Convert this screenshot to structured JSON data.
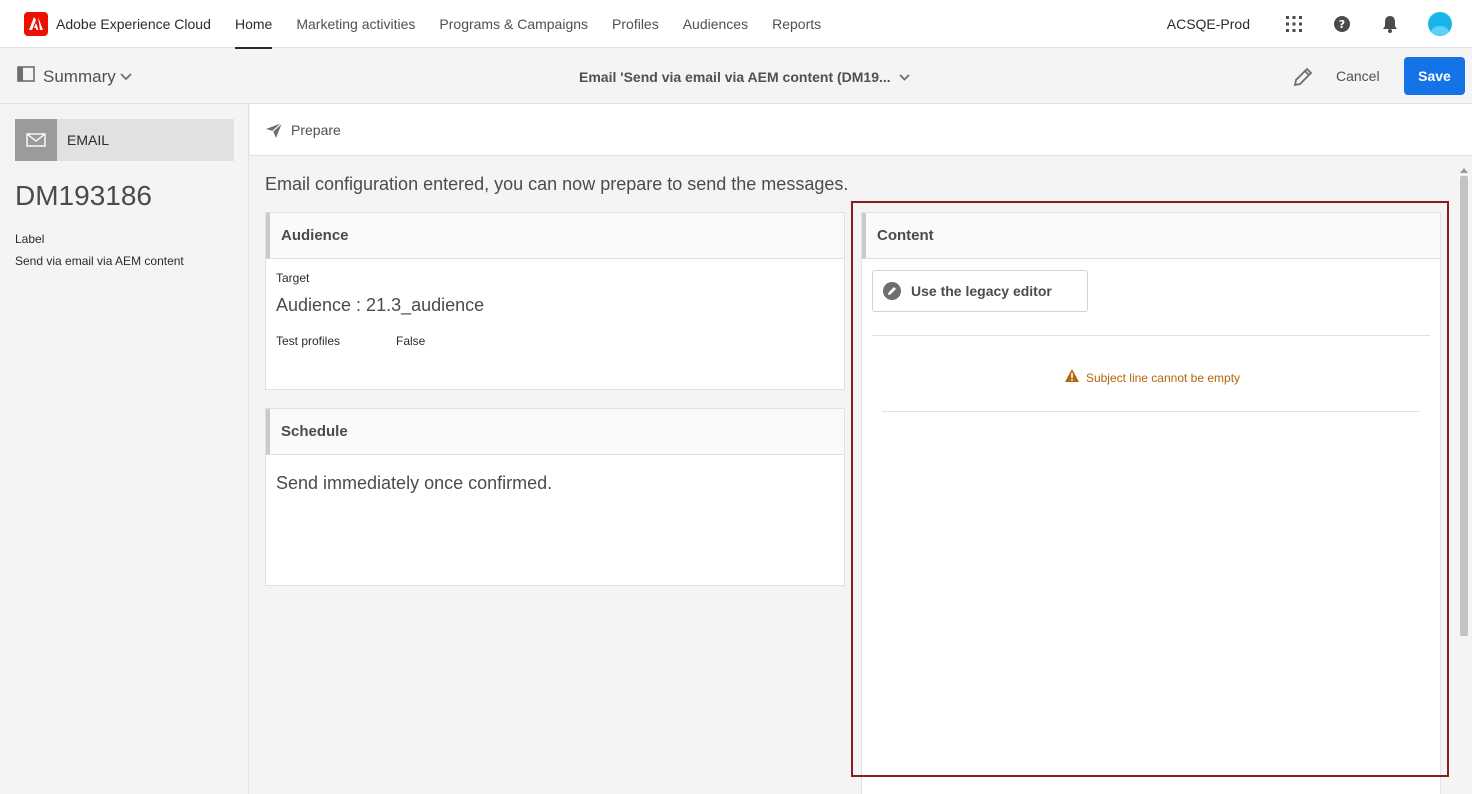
{
  "topnav": {
    "brand": "Adobe Experience Cloud",
    "tabs": [
      "Home",
      "Marketing activities",
      "Programs & Campaigns",
      "Profiles",
      "Audiences",
      "Reports"
    ],
    "active_tab": "Home",
    "org": "ACSQE-Prod",
    "icons": [
      "apps-grid-icon",
      "help-icon",
      "bell-icon",
      "user-avatar"
    ]
  },
  "actionbar": {
    "summary_label": "Summary",
    "title": "Email 'Send via email via AEM content (DM19...",
    "cancel_label": "Cancel",
    "save_label": "Save",
    "accent": "#1473e6"
  },
  "left": {
    "channel": "EMAIL",
    "delivery_id": "DM193186",
    "label_key": "Label",
    "label_value": "Send via email via AEM content"
  },
  "main": {
    "prepare_label": "Prepare",
    "info_message": "Email configuration entered, you can now prepare to send the messages.",
    "audience": {
      "title": "Audience",
      "target_label": "Target",
      "target_value": "Audience : 21.3_audience",
      "test_profiles_label": "Test profiles",
      "test_profiles_value": "False"
    },
    "schedule": {
      "title": "Schedule",
      "value": "Send immediately once confirmed."
    },
    "content": {
      "title": "Content",
      "legacy_editor_label": "Use the legacy editor",
      "warning": "Subject line cannot be empty",
      "warning_color": "#b5650c",
      "highlight_color": "#8a1c1c"
    }
  }
}
